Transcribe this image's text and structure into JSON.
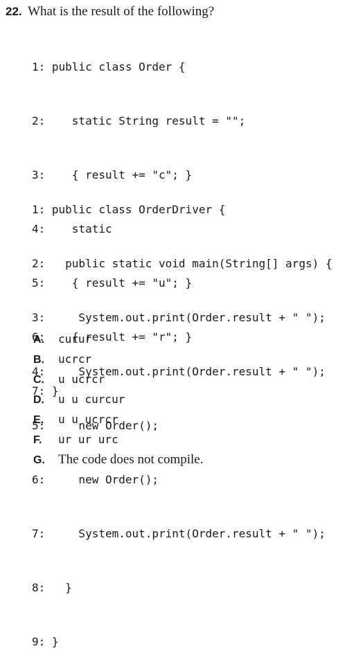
{
  "question": {
    "number": "22.",
    "text": "What is the result of the following?"
  },
  "code_blocks": [
    {
      "lines": [
        {
          "num": "1:",
          "code": " public class Order {"
        },
        {
          "num": "2:",
          "code": "    static String result = \"\";"
        },
        {
          "num": "3:",
          "code": "    { result += \"c\"; }"
        },
        {
          "num": "4:",
          "code": "    static"
        },
        {
          "num": "5:",
          "code": "    { result += \"u\"; }"
        },
        {
          "num": "6:",
          "code": "    { result += \"r\"; }"
        },
        {
          "num": "7:",
          "code": " }"
        }
      ]
    },
    {
      "lines": [
        {
          "num": "1:",
          "code": " public class OrderDriver {"
        },
        {
          "num": "2:",
          "code": "   public static void main(String[] args) {"
        },
        {
          "num": "3:",
          "code": "     System.out.print(Order.result + \" \");"
        },
        {
          "num": "4:",
          "code": "     System.out.print(Order.result + \" \");"
        },
        {
          "num": "5:",
          "code": "     new Order();"
        },
        {
          "num": "6:",
          "code": "     new Order();"
        },
        {
          "num": "7:",
          "code": "     System.out.print(Order.result + \" \");"
        },
        {
          "num": "8:",
          "code": "   }"
        },
        {
          "num": "9:",
          "code": " }"
        }
      ]
    }
  ],
  "answers": [
    {
      "letter": "A.",
      "text": "curur"
    },
    {
      "letter": "B.",
      "text": "ucrcr"
    },
    {
      "letter": "C.",
      "text": "u ucrcr"
    },
    {
      "letter": "D.",
      "text": "u u curcur"
    },
    {
      "letter": "E.",
      "text": "u u ucrcr"
    },
    {
      "letter": "F.",
      "text": "ur ur urc"
    },
    {
      "letter": "G.",
      "text": "The code does not compile."
    }
  ]
}
